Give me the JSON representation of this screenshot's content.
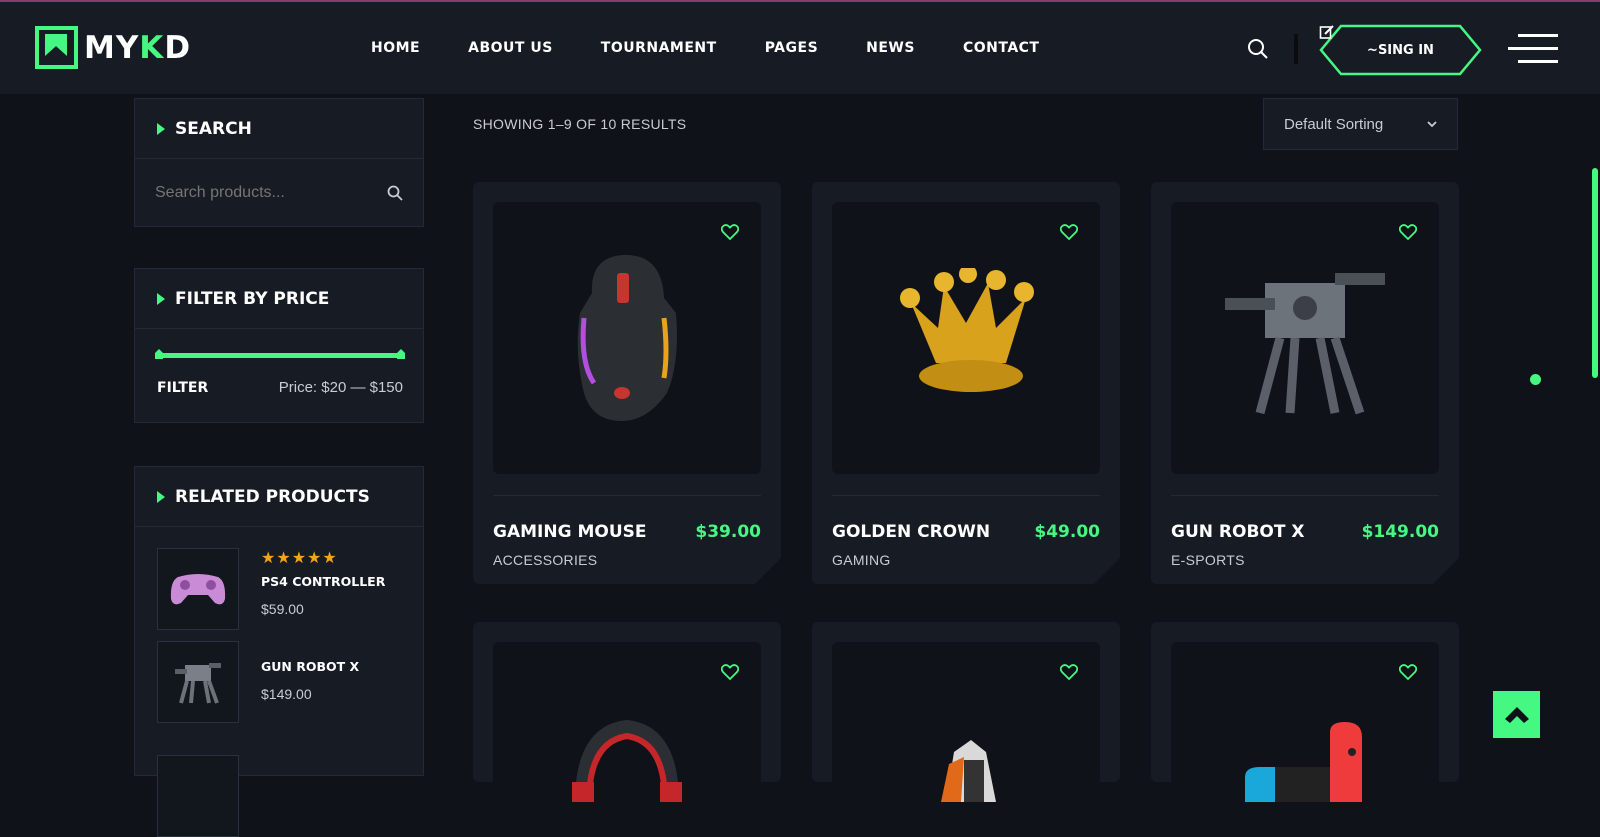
{
  "brand": {
    "logo_text_a": "MY",
    "logo_text_b": "K",
    "logo_text_c": "D",
    "accent": "#45f882"
  },
  "nav": {
    "items": [
      "HOME",
      "ABOUT US",
      "TOURNAMENT",
      "PAGES",
      "NEWS",
      "CONTACT"
    ]
  },
  "header": {
    "signin_label": "~SING IN"
  },
  "sidebar": {
    "search": {
      "title": "SEARCH",
      "placeholder": "Search products..."
    },
    "filter": {
      "title": "FILTER BY PRICE",
      "button_label": "FILTER",
      "price_text": "Price: $20 — $150"
    },
    "related": {
      "title": "RELATED PRODUCTS",
      "items": [
        {
          "name": "PS4 CONTROLLER",
          "price": "$59.00",
          "rating": "★★★★★"
        },
        {
          "name": "GUN ROBOT X",
          "price": "$149.00"
        }
      ]
    }
  },
  "main": {
    "results_text": "SHOWING 1–9 OF 10 RESULTS",
    "sorting": {
      "selected": "Default Sorting"
    },
    "products": [
      {
        "name": "GAMING MOUSE",
        "price": "$39.00",
        "category": "ACCESSORIES"
      },
      {
        "name": "GOLDEN CROWN",
        "price": "$49.00",
        "category": "GAMING"
      },
      {
        "name": "GUN ROBOT X",
        "price": "$149.00",
        "category": "E-SPORTS"
      }
    ]
  }
}
